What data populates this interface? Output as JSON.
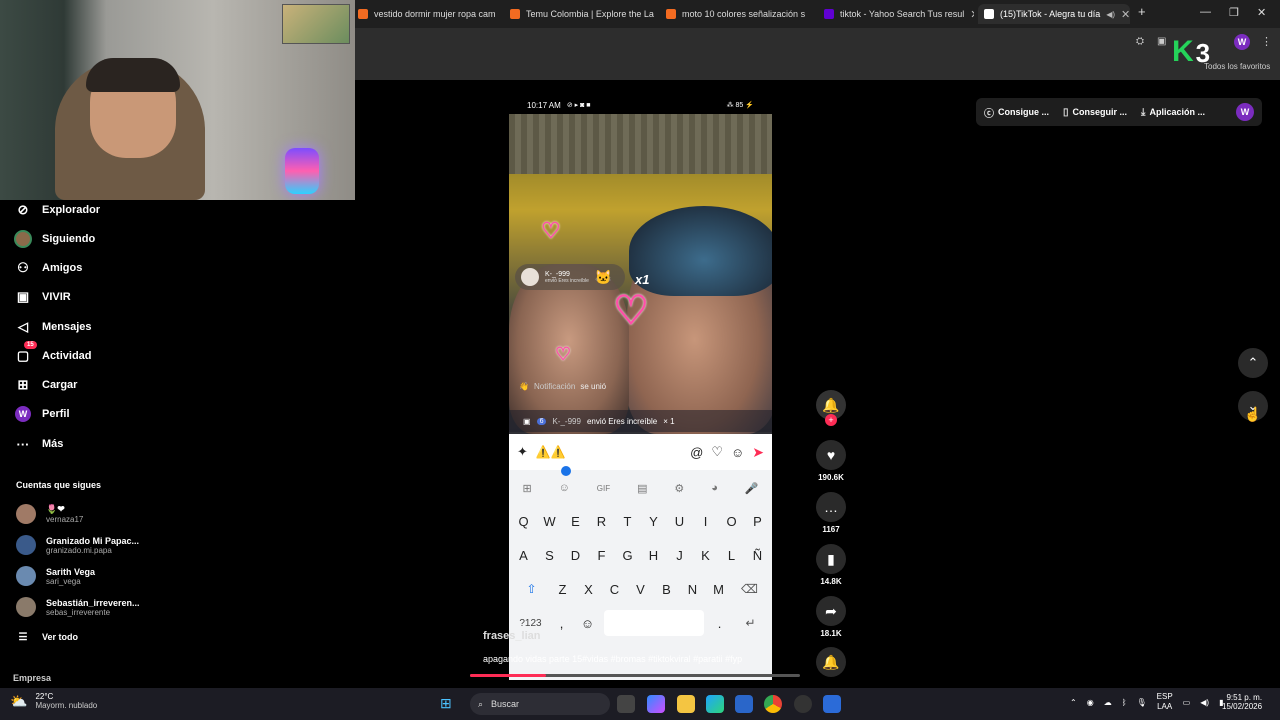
{
  "browser": {
    "tabs": [
      {
        "label": "vestido dormir mujer ropa cam",
        "active": false,
        "favicon_color": "#f36b21"
      },
      {
        "label": "Temu Colombia | Explore the La",
        "active": false,
        "favicon_color": "#f36b21"
      },
      {
        "label": "moto 10 colores señalización s",
        "active": false,
        "favicon_color": "#f36b21"
      },
      {
        "label": "tiktok - Yahoo Search Tus resul",
        "active": false,
        "favicon_color": "#6001d2"
      },
      {
        "label": "(15)TikTok - Alegra tu día",
        "active": true,
        "favicon_color": "#ffffff"
      }
    ],
    "new_tab": "+",
    "bookmarks_label": "Todos los favoritos",
    "profile_initial": "W",
    "window_controls": {
      "minimize": "—",
      "restore": "❐",
      "close": "✕"
    }
  },
  "overlay_badge": {
    "letter": "K",
    "number": "3",
    "color": "#25d35a"
  },
  "header_pills": [
    {
      "icon": "ⓒ",
      "label": "Consigue ..."
    },
    {
      "icon": "▯",
      "label": "Conseguir ..."
    },
    {
      "icon": "⤓",
      "label": "Aplicación ..."
    }
  ],
  "header_avatar": "W",
  "sidebar": {
    "items": [
      {
        "icon": "⊘",
        "label": "Explorador"
      },
      {
        "icon": "●",
        "label": "Siguiendo"
      },
      {
        "icon": "⚇",
        "label": "Amigos"
      },
      {
        "icon": "▣",
        "label": "VIVIR"
      },
      {
        "icon": "◁",
        "label": "Mensajes"
      },
      {
        "icon": "▢",
        "label": "Actividad",
        "badge": "15"
      },
      {
        "icon": "⊞",
        "label": "Cargar"
      },
      {
        "icon": "W",
        "label": "Perfil"
      },
      {
        "icon": "···",
        "label": "Más"
      }
    ],
    "following_title": "Cuentas que sigues",
    "following": [
      {
        "name": "🌷❤",
        "handle": "vernaza17"
      },
      {
        "name": "Granizado Mi Papac...",
        "handle": "granizado.mi.papa"
      },
      {
        "name": "Sarith Vega",
        "handle": "sari_vega"
      },
      {
        "name": "Sebastián_irreveren...",
        "handle": "sebas_irreverente"
      }
    ],
    "see_all": "Ver todo",
    "footer": "Empresa"
  },
  "phone": {
    "status_time": "10:17 AM",
    "status_icons_left": "⊘ ▸ ◙ ■",
    "status_icons_right": "⁂ 85 ⚡",
    "gift_toast": {
      "user": "K-_-999",
      "text": "envió Eres increíble",
      "multiplier": "x1"
    },
    "notification": {
      "user": "Notificación",
      "text": "se unió"
    },
    "gift_line": {
      "level": "6",
      "user": "K-_-999",
      "text": "envió Eres increíble",
      "count": "× 1"
    },
    "keyboard": {
      "input_emoji": "⚠️⚠️",
      "tool_icons": [
        "⊞",
        "☺",
        "GIF",
        "▤",
        "⚙",
        "◕",
        "🎤"
      ],
      "rows": [
        [
          "Q",
          "W",
          "E",
          "R",
          "T",
          "Y",
          "U",
          "I",
          "O",
          "P"
        ],
        [
          "A",
          "S",
          "D",
          "F",
          "G",
          "H",
          "J",
          "K",
          "L",
          "Ñ"
        ],
        [
          "Z",
          "X",
          "C",
          "V",
          "B",
          "N",
          "M"
        ]
      ],
      "shift": "⇧",
      "backspace": "⌫",
      "numbers": "?123",
      "comma": ",",
      "emoji": "☺",
      "period": ".",
      "enter": "↵"
    }
  },
  "video": {
    "username": "frases_lian",
    "caption": "apagando vidas parte 15#vidas #bromas #tiktokviral #paratii #fyp",
    "progress": 0.23
  },
  "actions": [
    {
      "name": "follow",
      "icon": "🔔",
      "count": ""
    },
    {
      "name": "like",
      "icon": "♥",
      "count": "190.6K"
    },
    {
      "name": "comment",
      "icon": "💬",
      "count": "1167"
    },
    {
      "name": "save",
      "icon": "🔖",
      "count": "14.8K"
    },
    {
      "name": "share",
      "icon": "➦",
      "count": "18.1K"
    }
  ],
  "nav": {
    "up": "⌃",
    "down": "⌄"
  },
  "taskbar": {
    "weather_temp": "22°C",
    "weather_desc": "Mayorm. nublado",
    "search_placeholder": "Buscar",
    "lang": "ESP",
    "region": "LAA",
    "time": "9:51 p. m.",
    "date": "15/02/2026"
  }
}
